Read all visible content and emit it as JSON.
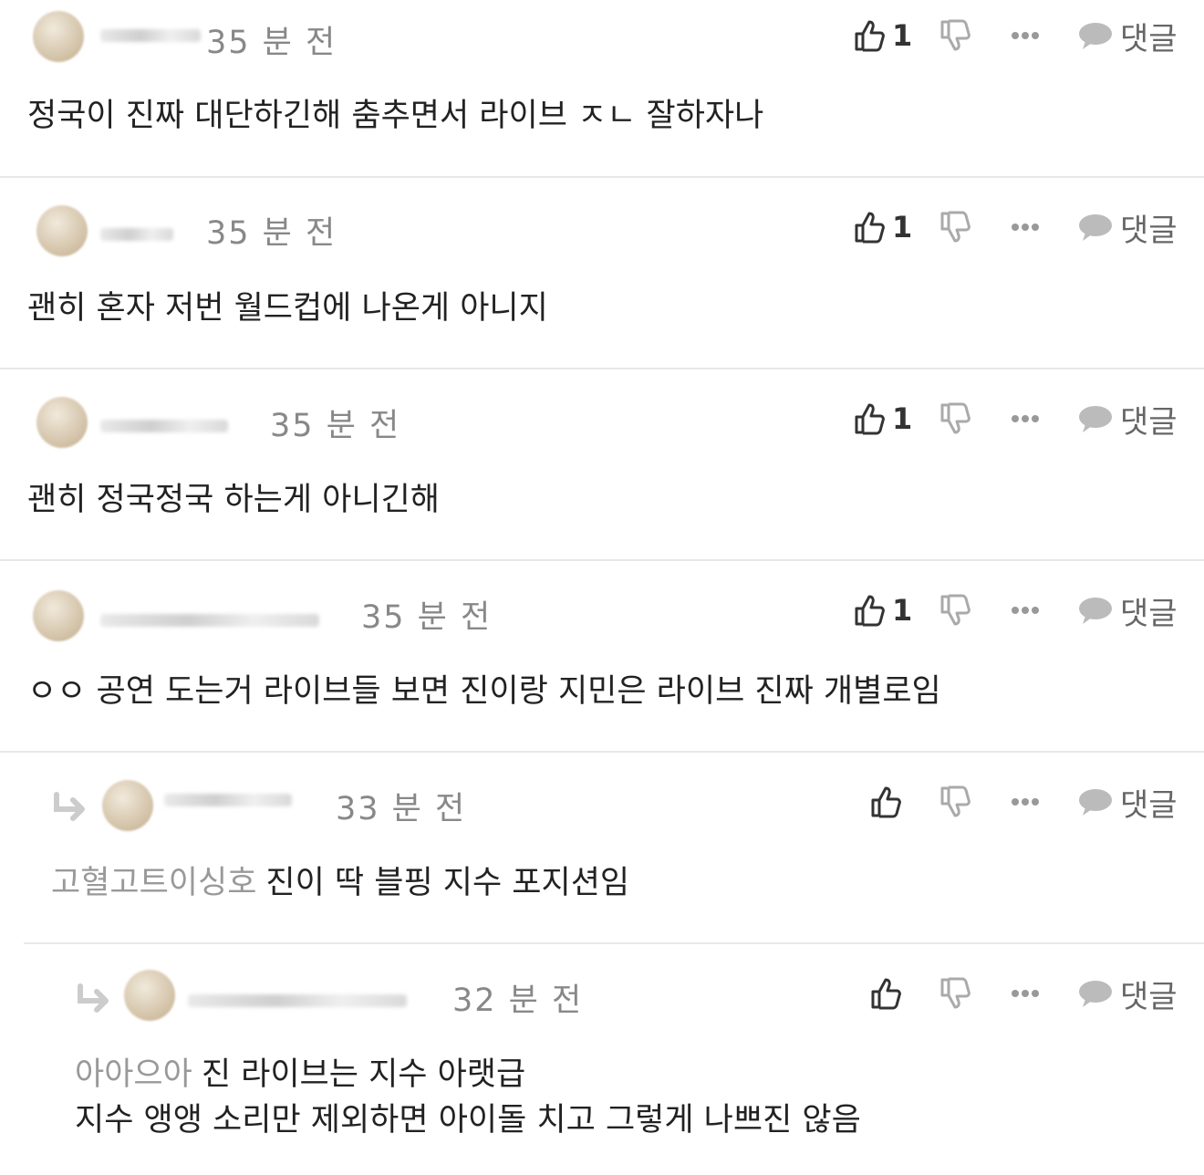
{
  "ui": {
    "reply_label": "댓글",
    "colors": {
      "text": "#222222",
      "muted": "#888888",
      "mention": "#999999",
      "divider": "#e8e8e8",
      "icon": "#444444"
    }
  },
  "comments": [
    {
      "time": "35 분 전",
      "likes": "1",
      "text": "정국이 진짜 대단하긴해 춤추면서 라이브 ㅈㄴ 잘하자나"
    },
    {
      "time": "35 분 전",
      "likes": "1",
      "text": "괜히 혼자 저번 월드컵에 나온게 아니지"
    },
    {
      "time": "35 분 전",
      "likes": "1",
      "text": "괜히 정국정국 하는게 아니긴해"
    },
    {
      "time": "35 분 전",
      "likes": "1",
      "text": "ㅇㅇ 공연 도는거 라이브들 보면 진이랑 지민은 라이브 진짜 개별로임"
    },
    {
      "time": "33 분 전",
      "likes": "",
      "mention": "고혈고트이싱호",
      "text": "진이 딱 블핑 지수 포지션임"
    },
    {
      "time": "32 분 전",
      "likes": "",
      "mention": "아아으아",
      "text": "진 라이브는 지수 아랫급",
      "text2": "지수 앵앵 소리만 제외하면 아이돌 치고 그렇게 나쁘진 않음"
    }
  ]
}
